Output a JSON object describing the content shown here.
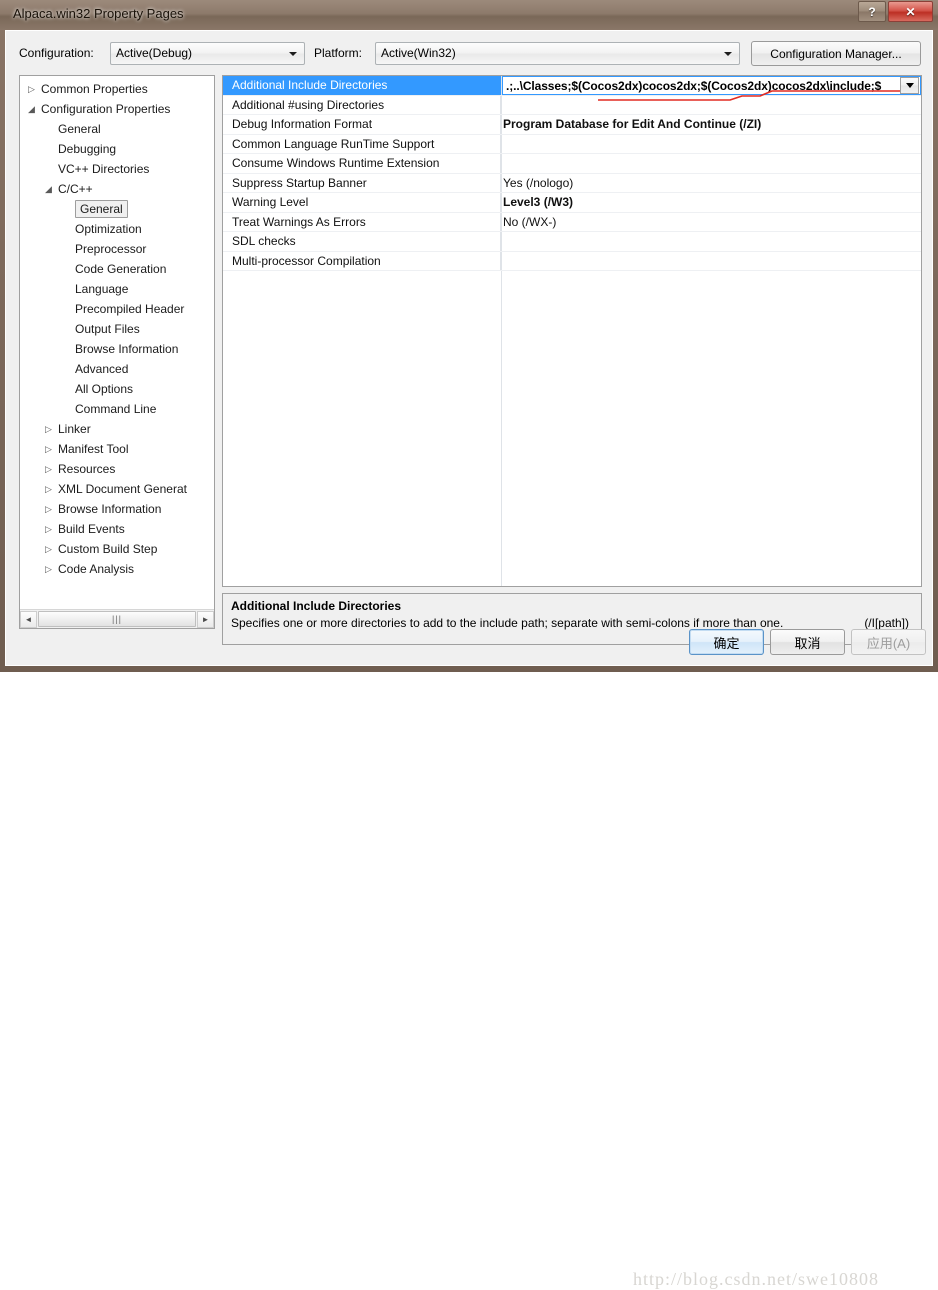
{
  "window": {
    "title": "Alpaca.win32 Property Pages",
    "help_button": "?",
    "close_button": "✕"
  },
  "toolbar": {
    "configuration_label": "Configuration:",
    "configuration_value": "Active(Debug)",
    "platform_label": "Platform:",
    "platform_value": "Active(Win32)",
    "config_manager_label": "Configuration Manager..."
  },
  "tree": {
    "items": [
      {
        "label": "Common Properties",
        "indent": 1,
        "twisty": "collapsed",
        "selected": false
      },
      {
        "label": "Configuration Properties",
        "indent": 1,
        "twisty": "expanded",
        "selected": false
      },
      {
        "label": "General",
        "indent": 2,
        "twisty": "none",
        "selected": false
      },
      {
        "label": "Debugging",
        "indent": 2,
        "twisty": "none",
        "selected": false
      },
      {
        "label": "VC++ Directories",
        "indent": 2,
        "twisty": "none",
        "selected": false
      },
      {
        "label": "C/C++",
        "indent": 2,
        "twisty": "expanded",
        "selected": false
      },
      {
        "label": "General",
        "indent": 3,
        "twisty": "none",
        "selected": true
      },
      {
        "label": "Optimization",
        "indent": 3,
        "twisty": "none",
        "selected": false
      },
      {
        "label": "Preprocessor",
        "indent": 3,
        "twisty": "none",
        "selected": false
      },
      {
        "label": "Code Generation",
        "indent": 3,
        "twisty": "none",
        "selected": false
      },
      {
        "label": "Language",
        "indent": 3,
        "twisty": "none",
        "selected": false
      },
      {
        "label": "Precompiled Header",
        "indent": 3,
        "twisty": "none",
        "selected": false
      },
      {
        "label": "Output Files",
        "indent": 3,
        "twisty": "none",
        "selected": false
      },
      {
        "label": "Browse Information",
        "indent": 3,
        "twisty": "none",
        "selected": false
      },
      {
        "label": "Advanced",
        "indent": 3,
        "twisty": "none",
        "selected": false
      },
      {
        "label": "All Options",
        "indent": 3,
        "twisty": "none",
        "selected": false
      },
      {
        "label": "Command Line",
        "indent": 3,
        "twisty": "none",
        "selected": false
      },
      {
        "label": "Linker",
        "indent": 2,
        "twisty": "collapsed",
        "selected": false
      },
      {
        "label": "Manifest Tool",
        "indent": 2,
        "twisty": "collapsed",
        "selected": false
      },
      {
        "label": "Resources",
        "indent": 2,
        "twisty": "collapsed",
        "selected": false
      },
      {
        "label": "XML Document Generat",
        "indent": 2,
        "twisty": "collapsed",
        "selected": false
      },
      {
        "label": "Browse Information",
        "indent": 2,
        "twisty": "collapsed",
        "selected": false
      },
      {
        "label": "Build Events",
        "indent": 2,
        "twisty": "collapsed",
        "selected": false
      },
      {
        "label": "Custom Build Step",
        "indent": 2,
        "twisty": "collapsed",
        "selected": false
      },
      {
        "label": "Code Analysis",
        "indent": 2,
        "twisty": "collapsed",
        "selected": false
      }
    ],
    "scroll_left_arrow": "◄",
    "scroll_right_arrow": "►",
    "scroll_thumb_grip": "|||"
  },
  "grid": {
    "rows": [
      {
        "name": "Additional Include Directories",
        "value": "",
        "bold": false,
        "selected": true,
        "editing": true
      },
      {
        "name": "Additional #using Directories",
        "value": "",
        "bold": false,
        "selected": false,
        "editing": false
      },
      {
        "name": "Debug Information Format",
        "value": "Program Database for Edit And Continue (/ZI)",
        "bold": true,
        "selected": false,
        "editing": false
      },
      {
        "name": "Common Language RunTime Support",
        "value": "",
        "bold": false,
        "selected": false,
        "editing": false
      },
      {
        "name": "Consume Windows Runtime Extension",
        "value": "",
        "bold": false,
        "selected": false,
        "editing": false
      },
      {
        "name": "Suppress Startup Banner",
        "value": "Yes (/nologo)",
        "bold": false,
        "selected": false,
        "editing": false
      },
      {
        "name": "Warning Level",
        "value": "Level3 (/W3)",
        "bold": true,
        "selected": false,
        "editing": false
      },
      {
        "name": "Treat Warnings As Errors",
        "value": "No (/WX-)",
        "bold": false,
        "selected": false,
        "editing": false
      },
      {
        "name": "SDL checks",
        "value": "",
        "bold": false,
        "selected": false,
        "editing": false
      },
      {
        "name": "Multi-processor Compilation",
        "value": "",
        "bold": false,
        "selected": false,
        "editing": false
      }
    ],
    "editor_value": ".;..\\Classes;$(Cocos2dx)cocos2dx;$(Cocos2dx)cocos2dx\\include;$",
    "editor_dropdown_icon": "chevron-down-icon"
  },
  "description": {
    "title": "Additional Include Directories",
    "body": "Specifies one or more directories to add to the include path; separate with semi-colons if more than one.",
    "flag": "(/I[path])"
  },
  "buttons": {
    "ok": "确定",
    "cancel": "取消",
    "apply": "应用(A)"
  },
  "watermark": {
    "text": "http://blog.csdn.net/swe10808"
  },
  "colors": {
    "selection_blue": "#3399ff",
    "annotation_red": "#e22b22",
    "frame_brown": "#8a7566"
  }
}
